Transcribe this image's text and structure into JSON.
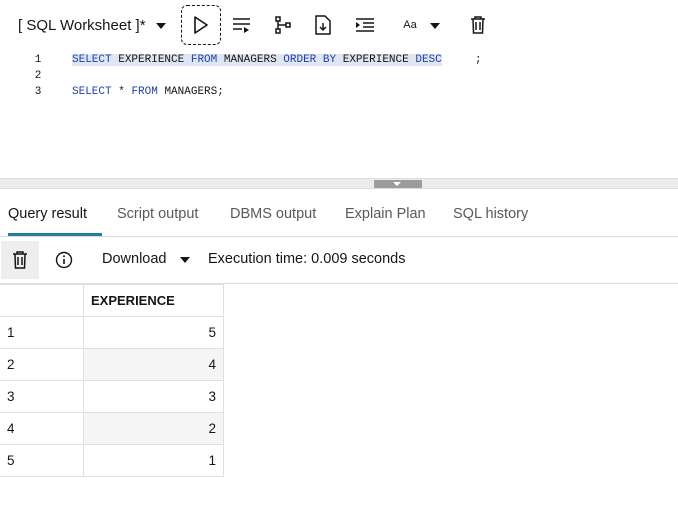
{
  "toolbar": {
    "worksheet_title": "[ SQL Worksheet ]*",
    "font_button_label": "Aa",
    "icons": [
      "chevron-down-icon",
      "run-icon",
      "format-icon",
      "explain-plan-icon",
      "script-run-icon",
      "indent-icon",
      "font-size-icon",
      "trash-icon"
    ]
  },
  "editor": {
    "lines": [
      {
        "num": "1",
        "tokens": [
          "SELECT",
          "EXPERIENCE",
          "FROM",
          "MANAGERS",
          "ORDER",
          "BY",
          "EXPERIENCE",
          "DESC",
          ";"
        ]
      },
      {
        "num": "2",
        "text": ""
      },
      {
        "num": "3",
        "tokens": [
          "SELECT",
          "*",
          "FROM",
          "MANAGERS",
          ";"
        ]
      }
    ]
  },
  "tabs": [
    {
      "label": "Query result",
      "active": true
    },
    {
      "label": "Script output"
    },
    {
      "label": "DBMS output"
    },
    {
      "label": "Explain Plan"
    },
    {
      "label": "SQL history"
    }
  ],
  "results_toolbar": {
    "download_label": "Download",
    "execution_time": "Execution time: 0.009 seconds"
  },
  "result_table": {
    "columns": [
      "",
      "EXPERIENCE"
    ],
    "rows": [
      {
        "num": "1",
        "value": "5"
      },
      {
        "num": "2",
        "value": "4"
      },
      {
        "num": "3",
        "value": "3"
      },
      {
        "num": "4",
        "value": "2"
      },
      {
        "num": "5",
        "value": "1"
      }
    ]
  },
  "colors": {
    "accent": "#227e9e",
    "keyword": "#1f3fb0",
    "selection": "#dfe6f3"
  }
}
